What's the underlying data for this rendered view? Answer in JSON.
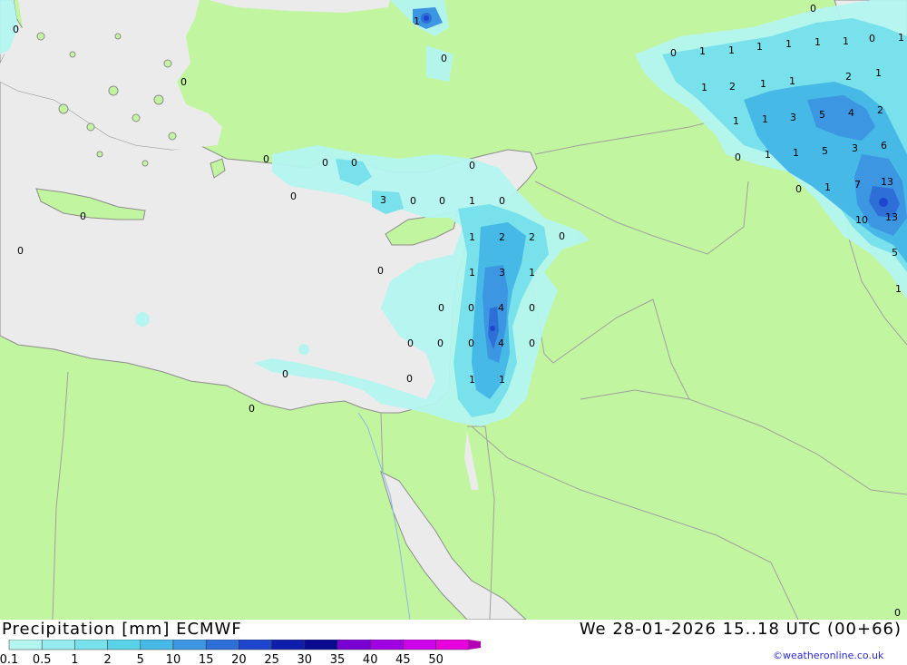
{
  "title": "Precipitation [mm] ECMWF",
  "valid_time": "We 28-01-2026 15..18 UTC (00+66)",
  "credit": "©weatheronline.co.uk",
  "colors": {
    "land": "#c2f5a0",
    "sea": "#ebebeb",
    "border": "#a0a0a0",
    "coast": "#8c8c8c"
  },
  "legend": {
    "ticks": [
      "0.1",
      "0.5",
      "1",
      "2",
      "5",
      "10",
      "15",
      "20",
      "25",
      "30",
      "35",
      "40",
      "45",
      "50"
    ],
    "colors": [
      "#b4f5f0",
      "#96ebee",
      "#78e1eb",
      "#5ad2e8",
      "#46b9e6",
      "#3c96e1",
      "#2d6ed7",
      "#1e46cd",
      "#0f1eaa",
      "#0a0a91",
      "#7800d2",
      "#a000e1",
      "#cd00eb",
      "#e600dc",
      "#b400b4"
    ]
  },
  "values": [
    {
      "t": "1"
    },
    {
      "t": "0"
    },
    {
      "t": "0"
    },
    {
      "t": "0"
    },
    {
      "t": "0"
    },
    {
      "t": "0"
    },
    {
      "t": "0"
    },
    {
      "t": "0"
    },
    {
      "t": "0"
    },
    {
      "t": "0"
    },
    {
      "t": "3"
    },
    {
      "t": "0"
    },
    {
      "t": "0"
    },
    {
      "t": "1"
    },
    {
      "t": "0"
    },
    {
      "t": "0"
    },
    {
      "t": "1"
    },
    {
      "t": "2"
    },
    {
      "t": "2"
    },
    {
      "t": "0"
    },
    {
      "t": "0"
    },
    {
      "t": "1"
    },
    {
      "t": "3"
    },
    {
      "t": "1"
    },
    {
      "t": "0"
    },
    {
      "t": "0"
    },
    {
      "t": "4"
    },
    {
      "t": "0"
    },
    {
      "t": "0"
    },
    {
      "t": "0"
    },
    {
      "t": "0"
    },
    {
      "t": "4"
    },
    {
      "t": "0"
    },
    {
      "t": "0"
    },
    {
      "t": "0"
    },
    {
      "t": "1"
    },
    {
      "t": "1"
    },
    {
      "t": "0"
    },
    {
      "t": "0"
    },
    {
      "t": "1"
    },
    {
      "t": "0"
    },
    {
      "t": "1"
    },
    {
      "t": "1"
    },
    {
      "t": "1"
    },
    {
      "t": "1"
    },
    {
      "t": "1"
    },
    {
      "t": "0"
    },
    {
      "t": "1"
    },
    {
      "t": "2"
    },
    {
      "t": "1"
    },
    {
      "t": "1"
    },
    {
      "t": "1"
    },
    {
      "t": "2"
    },
    {
      "t": "1"
    },
    {
      "t": "1"
    },
    {
      "t": "1"
    },
    {
      "t": "3"
    },
    {
      "t": "5"
    },
    {
      "t": "4"
    },
    {
      "t": "2"
    },
    {
      "t": "0"
    },
    {
      "t": "1"
    },
    {
      "t": "1"
    },
    {
      "t": "5"
    },
    {
      "t": "3"
    },
    {
      "t": "6"
    },
    {
      "t": "0"
    },
    {
      "t": "1"
    },
    {
      "t": "7"
    },
    {
      "t": "13"
    },
    {
      "t": "10"
    },
    {
      "t": "13"
    },
    {
      "t": "5"
    },
    {
      "t": "1"
    },
    {
      "t": "0"
    }
  ]
}
